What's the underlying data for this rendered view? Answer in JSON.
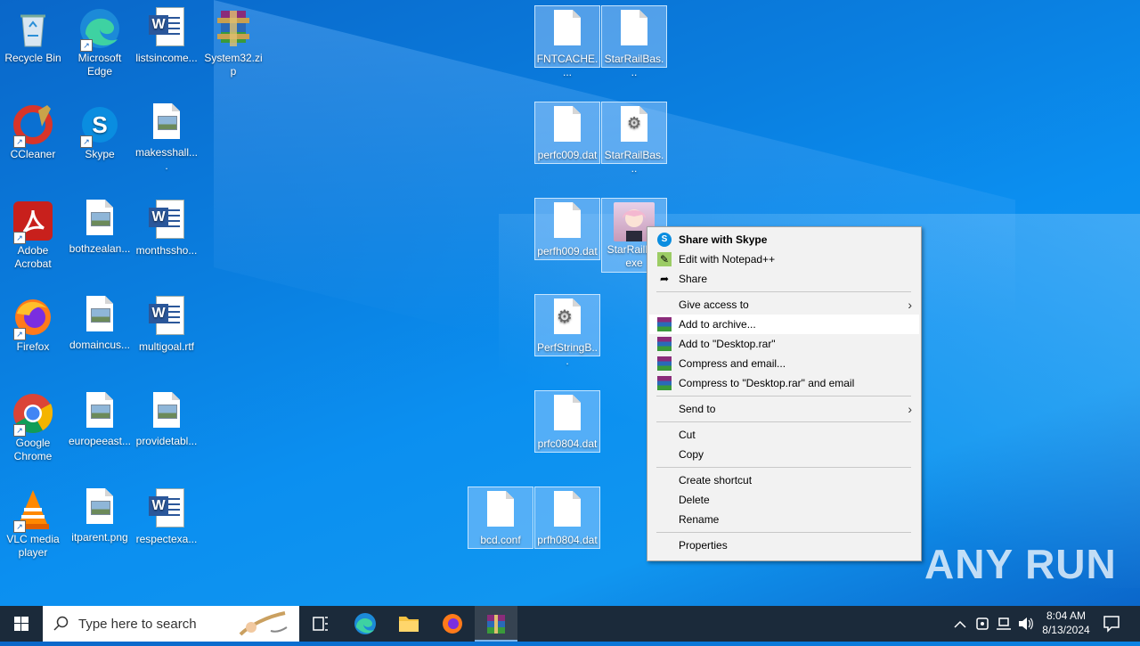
{
  "desktop": {
    "icons": [
      {
        "label": "Recycle Bin",
        "icon": "recycle-bin-icon"
      },
      {
        "label": "Microsoft Edge",
        "icon": "edge-icon"
      },
      {
        "label": "listsincome...",
        "icon": "word-doc-icon"
      },
      {
        "label": "System32.zip",
        "icon": "winrar-archive-icon"
      },
      {
        "label": "CCleaner",
        "icon": "ccleaner-icon"
      },
      {
        "label": "Skype",
        "icon": "skype-icon"
      },
      {
        "label": "makesshall....",
        "icon": "image-file-icon"
      },
      {
        "label": "Adobe Acrobat",
        "icon": "acrobat-icon"
      },
      {
        "label": "bothzealan...",
        "icon": "image-file-icon"
      },
      {
        "label": "monthssho...",
        "icon": "word-doc-icon"
      },
      {
        "label": "Firefox",
        "icon": "firefox-icon"
      },
      {
        "label": "domaincus...",
        "icon": "image-file-icon"
      },
      {
        "label": "multigoal.rtf",
        "icon": "word-doc-icon"
      },
      {
        "label": "Google Chrome",
        "icon": "chrome-icon"
      },
      {
        "label": "europeeast...",
        "icon": "image-file-icon"
      },
      {
        "label": "providetabl...",
        "icon": "image-file-icon"
      },
      {
        "label": "VLC media player",
        "icon": "vlc-icon"
      },
      {
        "label": "itparent.png",
        "icon": "image-file-icon"
      },
      {
        "label": "respectexa...",
        "icon": "word-doc-icon"
      }
    ],
    "selected_files": [
      {
        "label": "FNTCACHE....",
        "icon": "blank-file-icon"
      },
      {
        "label": "StarRailBas...",
        "icon": "blank-file-icon"
      },
      {
        "label": "perfc009.dat",
        "icon": "blank-file-icon"
      },
      {
        "label": "StarRailBas...",
        "icon": "settings-file-icon"
      },
      {
        "label": "perfh009.dat",
        "icon": "blank-file-icon"
      },
      {
        "label": "StarRailB... exe",
        "icon": "anime-app-icon"
      },
      {
        "label": "PerfStringB...",
        "icon": "settings-file-icon"
      },
      {
        "label": "prfc0804.dat",
        "icon": "blank-file-icon"
      },
      {
        "label": "bcd.conf",
        "icon": "blank-file-icon"
      },
      {
        "label": "prfh0804.dat",
        "icon": "blank-file-icon"
      }
    ]
  },
  "context_menu": {
    "share_skype": "Share with Skype",
    "edit_notepad": "Edit with Notepad++",
    "share": "Share",
    "give_access": "Give access to",
    "add_archive": "Add to archive...",
    "add_desktop_rar": "Add to \"Desktop.rar\"",
    "compress_email": "Compress and email...",
    "compress_desktop_email": "Compress to \"Desktop.rar\" and email",
    "send_to": "Send to",
    "cut": "Cut",
    "copy": "Copy",
    "create_shortcut": "Create shortcut",
    "delete": "Delete",
    "rename": "Rename",
    "properties": "Properties"
  },
  "taskbar": {
    "search_placeholder": "Type here to search",
    "time": "8:04 AM",
    "date": "8/13/2024"
  },
  "watermark": "ANY RUN"
}
